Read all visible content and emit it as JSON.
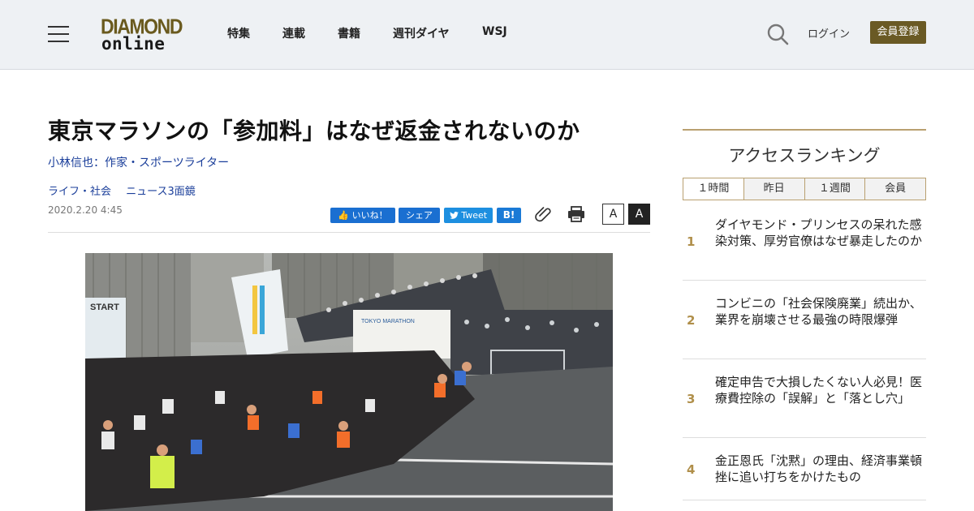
{
  "header": {
    "logo_top": "DIAMOND",
    "logo_bottom": "online",
    "nav": [
      "特集",
      "連載",
      "書籍",
      "週刊ダイヤ",
      "WSJ"
    ],
    "login": "ログイン",
    "register": "会員登録"
  },
  "article": {
    "title": "東京マラソンの「参加料」はなぜ返金されないのか",
    "author": "小林信也：作家・スポーツライター",
    "categories": [
      "ライフ・社会",
      "ニュース3面鏡"
    ],
    "date": "2020.2.20 4:45"
  },
  "share": {
    "like": "いいね！",
    "share": "シェア",
    "tweet": "Tweet",
    "hatena": "B!",
    "font_small": "A",
    "font_large": "A"
  },
  "sidebar": {
    "title": "アクセスランキング",
    "tabs": [
      "１時間",
      "昨日",
      "１週間",
      "会員"
    ],
    "active_tab": "１時間",
    "items": [
      {
        "rank": "1",
        "text": "ダイヤモンド・プリンセスの呆れた感染対策、厚労官僚はなぜ暴走したのか"
      },
      {
        "rank": "2",
        "text": "コンビニの「社会保険廃業」続出か、業界を崩壊させる最強の時限爆弾"
      },
      {
        "rank": "3",
        "text": "確定申告で大損したくない人必見！医療費控除の「誤解」と「落とし穴」"
      },
      {
        "rank": "4",
        "text": "金正恩氏「沈黙」の理由、経済事業頓挫に追い打ちをかけたもの"
      }
    ]
  },
  "photo": {
    "banner_text": "TOKYO MARATHON",
    "start_text": "START"
  },
  "colors": {
    "accent_gold": "#b9a070",
    "register_bg": "#6a5a24",
    "link_blue": "#1a3e9a",
    "facebook_blue": "#1a6fd1"
  }
}
